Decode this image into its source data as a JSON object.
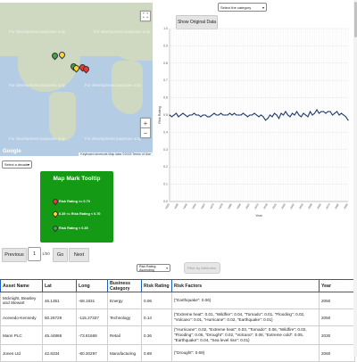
{
  "map": {
    "dev_text": "For development purposes only",
    "google": "Google",
    "footer": "Keyboard shortcuts   Map data ©2023   Terms of Use",
    "fullscreen_icon": "fullscreen-icon",
    "zoom_in": "+",
    "zoom_out": "−"
  },
  "controls": {
    "show_original": "Show Original Data",
    "category_select": "Select the category",
    "decade_select": "Select a decade",
    "sort_select": "Risk Rating: Ascending",
    "filter_placeholder": "Filter by Attributes"
  },
  "tooltip": {
    "title": "Map Mark Tooltip",
    "rows": [
      {
        "label": "Risk Rating >= 0.70",
        "color": "#e53935"
      },
      {
        "label": "0.35 <= Risk Rating < 0.70",
        "color": "#fdd835"
      },
      {
        "label": "Risk Rating < 0.35",
        "color": "#43a047"
      }
    ]
  },
  "pagination": {
    "previous": "Previous",
    "page": "1",
    "of": "1/50",
    "go": "Go",
    "next": "Next"
  },
  "chart_data": {
    "type": "line",
    "xlabel": "Year",
    "ylabel": "Risk Rating",
    "x": [
      1930,
      1932,
      1934,
      1936,
      1938,
      1940,
      1942,
      1944,
      1946,
      1948,
      1950,
      1952,
      1954,
      1956,
      1958,
      1960,
      1962,
      1964,
      1966,
      1968,
      1970,
      1972,
      1974,
      1976,
      1978,
      1980,
      1982,
      1984,
      1986,
      1988,
      1990,
      1992,
      1994,
      1996,
      1998,
      2000,
      2002,
      2004,
      2006,
      2008,
      2010,
      2012,
      2014,
      2016,
      2018,
      2020,
      2022,
      2024,
      2026,
      2028,
      2030,
      2032,
      2034,
      2036,
      2038,
      2040,
      2042,
      2044,
      2046,
      2048,
      2050,
      2052,
      2054,
      2056,
      2058,
      2060,
      2062,
      2064,
      2066,
      2068,
      2070,
      2072,
      2074,
      2076,
      2078,
      2080,
      2082,
      2084,
      2086,
      2088,
      2090
    ],
    "values": [
      0.5,
      0.49,
      0.5,
      0.51,
      0.49,
      0.5,
      0.51,
      0.5,
      0.49,
      0.5,
      0.5,
      0.51,
      0.5,
      0.5,
      0.49,
      0.5,
      0.5,
      0.49,
      0.49,
      0.5,
      0.51,
      0.5,
      0.5,
      0.51,
      0.5,
      0.5,
      0.5,
      0.51,
      0.5,
      0.51,
      0.5,
      0.5,
      0.5,
      0.51,
      0.5,
      0.49,
      0.5,
      0.5,
      0.51,
      0.5,
      0.49,
      0.5,
      0.49,
      0.47,
      0.48,
      0.5,
      0.49,
      0.51,
      0.5,
      0.48,
      0.51,
      0.5,
      0.52,
      0.5,
      0.49,
      0.51,
      0.5,
      0.52,
      0.5,
      0.49,
      0.51,
      0.5,
      0.49,
      0.52,
      0.5,
      0.51,
      0.53,
      0.51,
      0.52,
      0.52,
      0.51,
      0.52,
      0.52,
      0.5,
      0.51,
      0.52,
      0.5,
      0.51,
      0.5,
      0.49,
      0.47
    ],
    "ylim": [
      0.0,
      1.0
    ],
    "grid": true,
    "line_color": "#1f3a68"
  },
  "table": {
    "headers": [
      "Asset Name",
      "Lat",
      "Long",
      "Business Category",
      "Risk Rating",
      "Risk Factors",
      "Year"
    ],
    "rows": [
      [
        "Mcknight, Beasley and Stewart",
        "46.1351",
        "-68.1831",
        "Energy",
        "0.06",
        "{\"Earthquake\": 0.06}",
        "2050"
      ],
      [
        "Acevedo-Kennedy",
        "50.26729",
        "-115.27337",
        "Technology",
        "0.14",
        "{\"Extreme heat\": 0.01, \"Wildfire\": 0.04, \"Tornado\": 0.01, \"Flooding\": 0.02, \"Volcano\": 0.01, \"Hurricane\": 0.02, \"Earthquake\": 0.01}",
        "2050"
      ],
      [
        "Mann PLC",
        "45.44868",
        "-73.81669",
        "Retail",
        "0.36",
        "{\"Hurricane\": 0.02, \"Extreme heat\": 0.03, \"Tornado\": 0.06, \"Wildfire\": 0.02, \"Flooding\": 0.05, \"Drought\": 0.02, \"Volcano\": 0.06, \"Extreme cold\": 0.05, \"Earthquake\": 0.04, \"Sea level rise\": 0.01}",
        "2030"
      ],
      [
        "Jones Ltd",
        "42.8334",
        "-80.30297",
        "Manufacturing",
        "0.69",
        "{\"Drought\": 0.69}",
        "2060"
      ]
    ]
  }
}
